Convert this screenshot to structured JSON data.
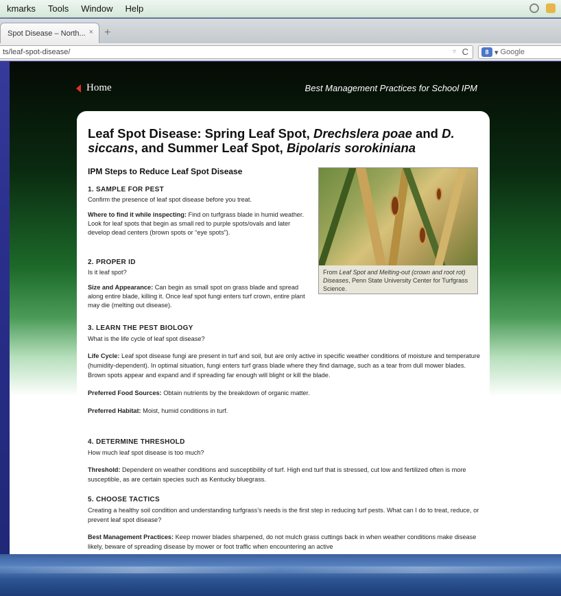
{
  "menubar": {
    "items": [
      "kmarks",
      "Tools",
      "Window",
      "Help"
    ]
  },
  "browser": {
    "tab_title": "Spot Disease – North...",
    "tab_close": "×",
    "new_tab": "+",
    "url": "ts/leaf-spot-disease/",
    "url_dropdown": "▿",
    "reload": "C",
    "search_engine_badge": "8",
    "search_placeholder": "Google",
    "search_dropdown": "▾"
  },
  "site": {
    "home_label": "Home",
    "tagline": "Best Management Practices for School IPM"
  },
  "article": {
    "title_1": "Leaf Spot Disease: Spring Leaf Spot, ",
    "title_2": "Drechslera poae",
    "title_3": " and ",
    "title_4": "D. siccans",
    "title_5": ", and Summer Leaf Spot, ",
    "title_6": "Bipolaris sorokiniana",
    "section_heading": "IPM Steps to Reduce Leaf Spot Disease",
    "step1_heading": "1. SAMPLE FOR PEST",
    "step1_text": "Confirm the presence of leaf spot disease before you treat.",
    "step1_find_label": "Where to find it while inspecting:",
    "step1_find_text": " Find on turfgrass blade in humid weather. Look for leaf spots that begin as small red to purple spots/ovals and later develop dead centers (brown spots or “eye spots”).",
    "step2_heading": "2. PROPER ID",
    "step2_text": "Is it leaf spot?",
    "step2_size_label": "Size and Appearance:",
    "step2_size_text": " Can begin as small spot on grass blade and spread along entire blade, killing it. Once leaf spot fungi enters turf crown, entire plant may die (melting out disease).",
    "step3_heading": "3. LEARN THE PEST BIOLOGY",
    "step3_text": "What is the life cycle of leaf spot disease?",
    "step3_life_label": "Life Cycle:",
    "step3_life_text": " Leaf spot disease fungi are present in turf and soil, but are only active in specific weather conditions of moisture and temperature (humidity-dependent). In optimal situation, fungi enters turf grass blade where they find damage, such as a tear from dull mower blades. Brown spots appear and expand and if spreading far enough will blight or kill the blade.",
    "step3_food_label": "Preferred Food Sources:",
    "step3_food_text": " Obtain nutrients by the breakdown of organic matter.",
    "step3_habitat_label": "Preferred Habitat:",
    "step3_habitat_text": " Moist, humid conditions in turf.",
    "step4_heading": "4. DETERMINE THRESHOLD",
    "step4_text": "How much leaf spot disease is too much?",
    "step4_threshold_label": "Threshold:",
    "step4_threshold_text": " Dependent on weather conditions and susceptibility of turf. High end turf that is stressed, cut low and fertilized often is more susceptible, as are certain species such as Kentucky bluegrass.",
    "step5_heading": "5. CHOOSE TACTICS",
    "step5_text": "Creating a healthy soil condition and understanding turfgrass’s needs is the first step in reducing turf pests. What can I do to treat, reduce, or prevent leaf spot disease?",
    "step5_bmp_label": "Best Management Practices:",
    "step5_bmp_text": " Keep mower blades sharpened, do not mulch grass cuttings back in when weather conditions make disease likely, beware of spreading disease by mower or foot traffic when encountering an active"
  },
  "photo": {
    "caption_prefix": "From ",
    "caption_title": "Leaf Spot and Melting-out (crown and root rot) Diseases",
    "caption_suffix": ", Penn State University Center for Turfgrass Science."
  }
}
